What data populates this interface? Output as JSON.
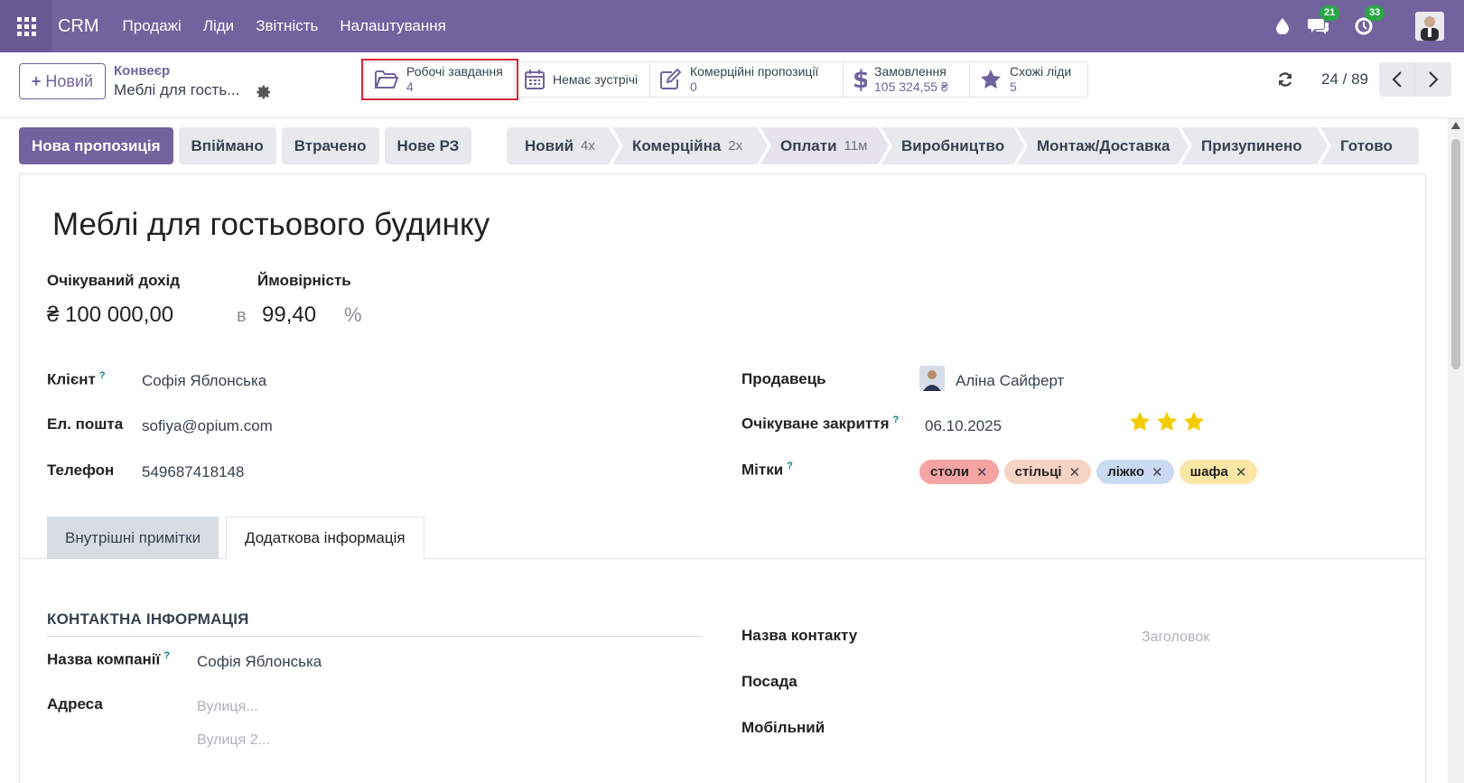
{
  "navbar": {
    "brand": "CRM",
    "menu": [
      "Продажі",
      "Ліди",
      "Звітність",
      "Налаштування"
    ],
    "chat_badge": "21",
    "activity_badge": "33"
  },
  "control": {
    "new_button": "Новий",
    "breadcrumb_parent": "Конвеєр",
    "breadcrumb_current": "Меблі для гость...",
    "stats": [
      {
        "label": "Робочі завдання",
        "value": "4",
        "icon": "folder-open-icon"
      },
      {
        "label": "Немає зустрічі",
        "value": "",
        "icon": "calendar-icon"
      },
      {
        "label": "Комерційні пропозиції",
        "value": "0",
        "icon": "edit-icon"
      },
      {
        "label": "Замовлення",
        "value": "105 324,55 ₴",
        "icon": "dollar-icon"
      },
      {
        "label": "Схожі ліди",
        "value": "5",
        "icon": "star-icon"
      }
    ],
    "pager": "24 / 89"
  },
  "actions": [
    "Нова пропозиція",
    "Впіймано",
    "Втрачено",
    "Нове РЗ"
  ],
  "stages": [
    {
      "label": "Новий",
      "count": "4x"
    },
    {
      "label": "Комерційна",
      "count": "2x"
    },
    {
      "label": "Оплати",
      "count": "11м"
    },
    {
      "label": "Виробництво",
      "count": ""
    },
    {
      "label": "Монтаж/Доставка",
      "count": ""
    },
    {
      "label": "Призупинено",
      "count": ""
    },
    {
      "label": "Готово",
      "count": ""
    }
  ],
  "active_stage": "Оплати",
  "lead": {
    "title": "Меблі для гостьового будинку",
    "expected_revenue_label": "Очікуваний дохід",
    "expected_revenue": "₴ 100 000,00",
    "in_word": "в",
    "probability_label": "Ймовірність",
    "probability": "99,40",
    "percent": "%",
    "client_label": "Клієнт",
    "client": "Софія Яблонська",
    "email_label": "Ел. пошта",
    "email": "sofiya@opium.com",
    "phone_label": "Телефон",
    "phone": "549687418148",
    "seller_label": "Продавець",
    "seller": "Аліна Сайферт",
    "close_label": "Очікуване закриття",
    "close_date": "06.10.2025",
    "priority_stars": 3,
    "tags_label": "Мітки",
    "tags": [
      {
        "name": "столи",
        "color": "#f5a3a3"
      },
      {
        "name": "стільці",
        "color": "#f7d3c4"
      },
      {
        "name": "ліжко",
        "color": "#c9daf2"
      },
      {
        "name": "шафа",
        "color": "#fbe6a6"
      }
    ],
    "help_mark": "?"
  },
  "tabs": [
    "Внутрішні примітки",
    "Додаткова інформація"
  ],
  "contact": {
    "section_title": "КОНТАКТНА ІНФОРМАЦІЯ",
    "company_label": "Назва компанії",
    "company": "Софія Яблонська",
    "address_label": "Адреса",
    "street_placeholder": "Вулиця...",
    "street2_placeholder": "Вулиця 2...",
    "contact_name_label": "Назва контакту",
    "title_placeholder": "Заголовок",
    "position_label": "Посада",
    "mobile_label": "Мобільний"
  },
  "colors": {
    "brand": "#71639e",
    "highlight": "#d9262e",
    "badge": "#28a745",
    "star": "#f3cc00"
  }
}
